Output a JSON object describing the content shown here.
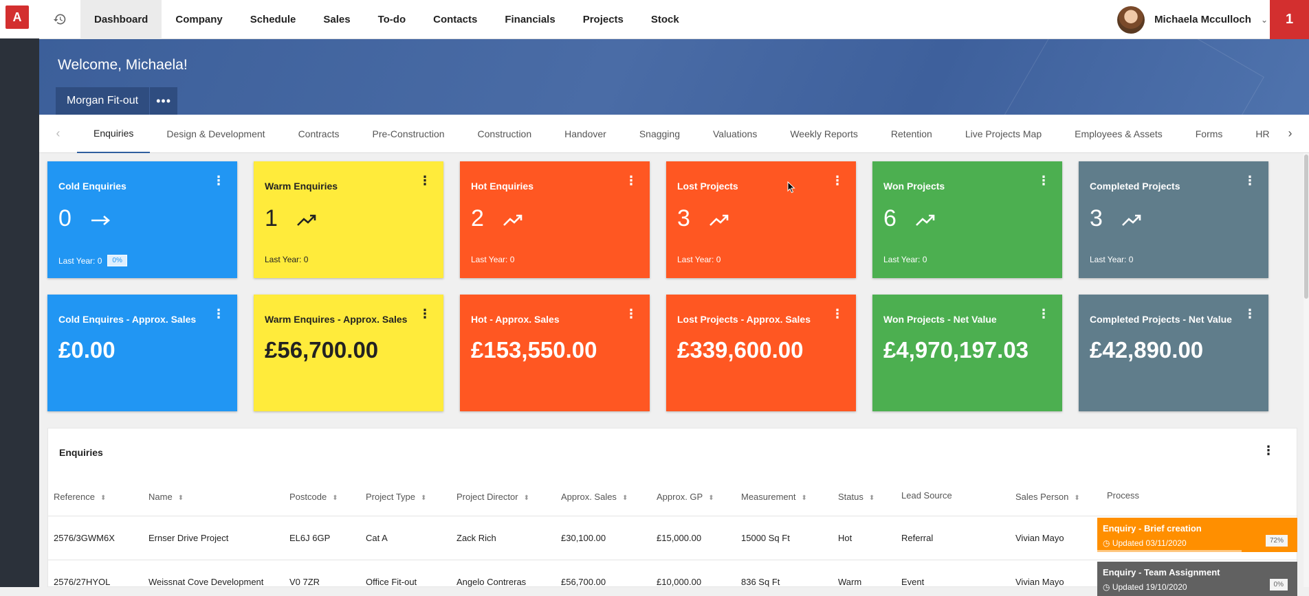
{
  "app": {
    "logo_letter": "A",
    "notification_count": "1"
  },
  "nav": {
    "items": [
      "Dashboard",
      "Company",
      "Schedule",
      "Sales",
      "To-do",
      "Contacts",
      "Financials",
      "Projects",
      "Stock"
    ],
    "active": "Dashboard"
  },
  "user": {
    "name": "Michaela Mcculloch"
  },
  "banner": {
    "welcome": "Welcome, Michaela!",
    "company": "Morgan Fit-out"
  },
  "tabs": {
    "items": [
      "Enquiries",
      "Design & Development",
      "Contracts",
      "Pre-Construction",
      "Construction",
      "Handover",
      "Snagging",
      "Valuations",
      "Weekly Reports",
      "Retention",
      "Live Projects Map",
      "Employees & Assets",
      "Forms",
      "HR"
    ],
    "active": "Enquiries"
  },
  "cards_row1": [
    {
      "title": "Cold Enquiries",
      "count": "0",
      "trend": "→",
      "foot": "Last Year: 0",
      "badge": "0%",
      "color": "#2196f3"
    },
    {
      "title": "Warm Enquiries",
      "count": "1",
      "trend": "↗",
      "foot": "Last Year: 0",
      "color": "#ffeb3b"
    },
    {
      "title": "Hot Enquiries",
      "count": "2",
      "trend": "↗",
      "foot": "Last Year: 0",
      "color": "#ff5722"
    },
    {
      "title": "Lost Projects",
      "count": "3",
      "trend": "↗",
      "foot": "Last Year: 0",
      "color": "#ff5722"
    },
    {
      "title": "Won Projects",
      "count": "6",
      "trend": "↗",
      "foot": "Last Year: 0",
      "color": "#4caf50"
    },
    {
      "title": "Completed Projects",
      "count": "3",
      "trend": "↗",
      "foot": "Last Year: 0",
      "color": "#607d8b"
    }
  ],
  "cards_row2": [
    {
      "title": "Cold Enquires - Approx. Sales",
      "value": "£0.00",
      "color": "#2196f3"
    },
    {
      "title": "Warm Enquires - Approx. Sales",
      "value": "£56,700.00",
      "color": "#ffeb3b"
    },
    {
      "title": "Hot - Approx. Sales",
      "value": "£153,550.00",
      "color": "#ff5722"
    },
    {
      "title": "Lost Projects - Approx. Sales",
      "value": "£339,600.00",
      "color": "#ff5722"
    },
    {
      "title": "Won Projects - Net Value",
      "value": "£4,970,197.03",
      "color": "#4caf50"
    },
    {
      "title": "Completed Projects - Net Value",
      "value": "£42,890.00",
      "color": "#607d8b"
    }
  ],
  "table": {
    "title": "Enquiries",
    "headers": [
      "Reference",
      "Name",
      "Postcode",
      "Project Type",
      "Project Director",
      "Approx. Sales",
      "Approx. GP",
      "Measurement",
      "Status",
      "Lead Source",
      "Sales Person",
      "Process"
    ],
    "rows": [
      [
        "2576/3GWM6X",
        "Ernser Drive Project",
        "EL6J 6GP",
        "Cat A",
        "Zack Rich",
        "£30,100.00",
        "£15,000.00",
        "15000 Sq Ft",
        "Hot",
        "Referral",
        "Vivian Mayo"
      ],
      [
        "2576/27HYOL",
        "Weissnat Cove Development",
        "V0 7ZR",
        "Office Fit-out",
        "Angelo Contreras",
        "£56,700.00",
        "£10,000.00",
        "836 Sq Ft",
        "Warm",
        "Event",
        "Vivian Mayo"
      ]
    ],
    "process": [
      {
        "title": "Enquiry - Brief creation",
        "updated": "Updated 03/11/2020",
        "pct": "72%",
        "progress": 0.72,
        "color": "#ff8f00"
      },
      {
        "title": "Enquiry - Team Assignment",
        "updated": "Updated 19/10/2020",
        "pct": "0%",
        "progress": 0,
        "color": "#616161"
      }
    ]
  }
}
